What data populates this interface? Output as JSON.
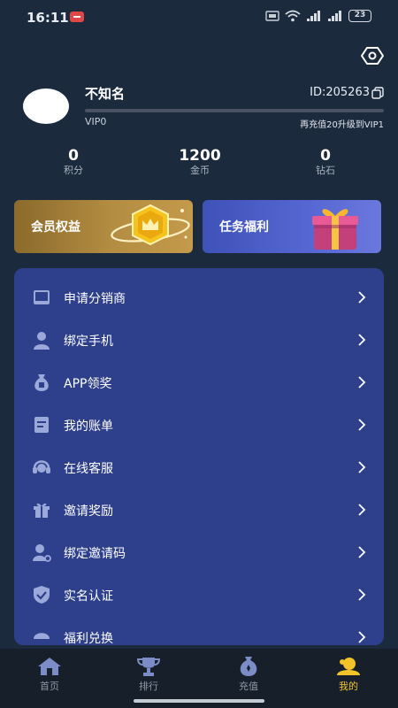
{
  "status_bar": {
    "time": "16:11",
    "battery": "23"
  },
  "profile": {
    "username": "不知名",
    "user_id": "ID:205263",
    "vip_level": "VIP0",
    "next_level_hint": "再充值20升级到VIP1",
    "progress": 0
  },
  "stats": [
    {
      "value": "0",
      "label": "积分"
    },
    {
      "value": "1200",
      "label": "金币"
    },
    {
      "value": "0",
      "label": "钻石"
    }
  ],
  "cards": {
    "vip": {
      "title": "会员权益"
    },
    "task": {
      "title": "任务福利"
    }
  },
  "menu": {
    "items": [
      {
        "label": "申请分销商",
        "icon": "tablet-icon"
      },
      {
        "label": "绑定手机",
        "icon": "person-icon"
      },
      {
        "label": "APP领奖",
        "icon": "money-bag-icon"
      },
      {
        "label": "我的账单",
        "icon": "bill-icon"
      },
      {
        "label": "在线客服",
        "icon": "headset-icon"
      },
      {
        "label": "邀请奖励",
        "icon": "gift-icon"
      },
      {
        "label": "绑定邀请码",
        "icon": "user-link-icon"
      },
      {
        "label": "实名认证",
        "icon": "shield-check-icon"
      },
      {
        "label": "福利兑换",
        "icon": "exchange-icon"
      }
    ]
  },
  "nav": {
    "items": [
      {
        "label": "首页",
        "icon": "home-icon"
      },
      {
        "label": "排行",
        "icon": "trophy-icon"
      },
      {
        "label": "充值",
        "icon": "recharge-bag-icon"
      },
      {
        "label": "我的",
        "icon": "profile-icon"
      }
    ],
    "active_index": 3
  },
  "colors": {
    "background": "#1c2a3d",
    "menu_panel": "#2e3f8c",
    "accent_gold": "#f3c42a",
    "vip_card": "#b38d42",
    "task_card": "#5667d3"
  }
}
